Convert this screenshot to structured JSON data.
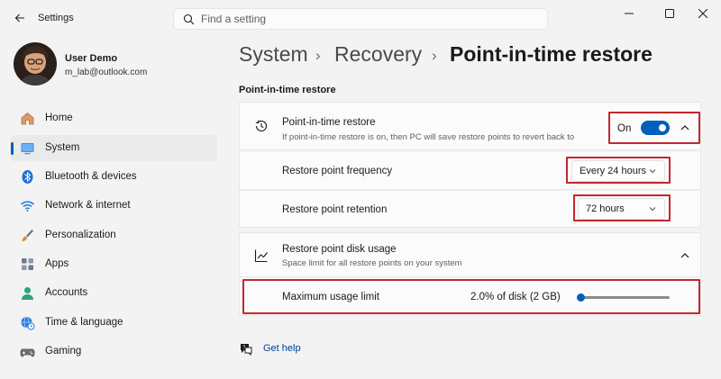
{
  "window": {
    "title": "Settings"
  },
  "search": {
    "placeholder": "Find a setting"
  },
  "user": {
    "name": "User Demo",
    "email": "m_lab@outlook.com"
  },
  "sidebar": {
    "items": [
      {
        "label": "Home",
        "icon": "home-icon"
      },
      {
        "label": "System",
        "icon": "system-icon",
        "active": true
      },
      {
        "label": "Bluetooth & devices",
        "icon": "bluetooth-icon"
      },
      {
        "label": "Network & internet",
        "icon": "wifi-icon"
      },
      {
        "label": "Personalization",
        "icon": "brush-icon"
      },
      {
        "label": "Apps",
        "icon": "apps-icon"
      },
      {
        "label": "Accounts",
        "icon": "person-icon"
      },
      {
        "label": "Time & language",
        "icon": "globe-clock-icon"
      },
      {
        "label": "Gaming",
        "icon": "gamepad-icon"
      }
    ]
  },
  "breadcrumb": {
    "system": "System",
    "recovery": "Recovery",
    "current": "Point-in-time restore",
    "separator": "›"
  },
  "main": {
    "section_title": "Point-in-time restore",
    "restore_card": {
      "title": "Point-in-time restore",
      "description": "If point-in-time restore is on, then PC will save restore points to revert back to",
      "toggle_label": "On",
      "toggle_on": true
    },
    "frequency": {
      "label": "Restore point frequency",
      "value": "Every 24 hours"
    },
    "retention": {
      "label": "Restore point retention",
      "value": "72 hours"
    },
    "disk_card": {
      "title": "Restore point disk usage",
      "description": "Space limit for all restore points on your system"
    },
    "max_usage": {
      "label": "Maximum usage limit",
      "value": "2.0% of disk (2 GB)",
      "slider_fraction": 0.0
    }
  },
  "help": {
    "label": "Get help"
  },
  "colors": {
    "accent": "#005fb8",
    "highlight": "#c4262e"
  }
}
